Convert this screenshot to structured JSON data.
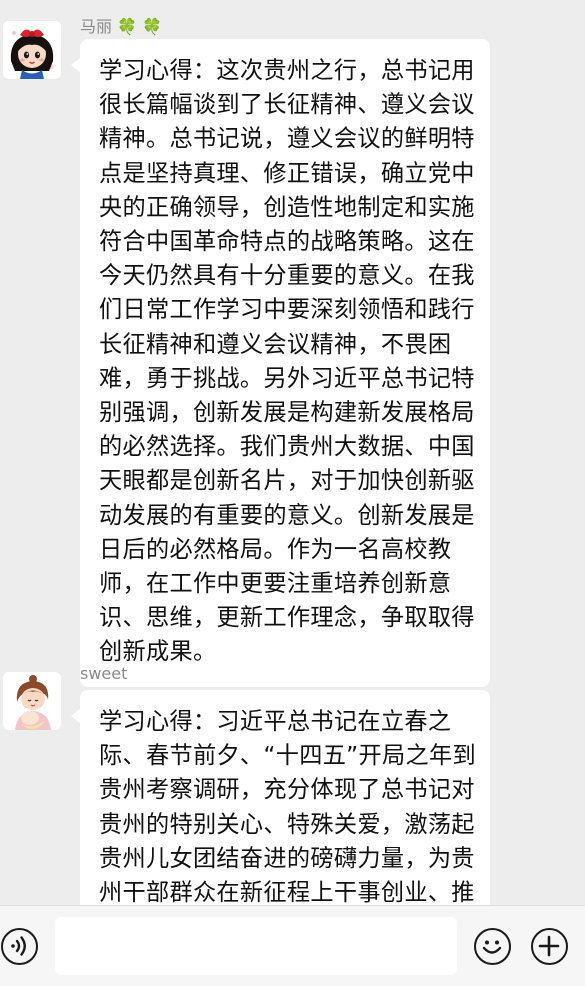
{
  "messages": [
    {
      "sender": "马丽",
      "sender_emoji": "🍀 🍀",
      "avatar_icon": "snow-white-cartoon-avatar",
      "text": "学习心得：这次贵州之行，总书记用很长篇幅谈到了长征精神、遵义会议精神。总书记说，遵义会议的鲜明特点是坚持真理、修正错误，确立党中央的正确领导，创造性地制定和实施符合中国革命特点的战略策略。这在今天仍然具有十分重要的意义。在我们日常工作学习中要深刻领悟和践行长征精神和遵义会议精神，不畏困难，勇于挑战。另外习近平总书记特别强调，创新发展是构建新发展格局的必然选择。我们贵州大数据、中国天眼都是创新名片，对于加快创新驱动发展的有重要的意义。创新发展是日后的必然格局。作为一名高校教师，在工作中更要注重培养创新意识、思维，更新工作理念，争取取得创新成果。"
    },
    {
      "sender": "sweet",
      "avatar_icon": "mother-and-baby-cartoon-avatar",
      "text": "学习心得：习近平总书记在立春之际、春节前夕、“十四五”开局之年到贵州考察调研，充分体现了总书记对贵州的特别关心、特殊关爱，激荡起贵州儿女团结奋进的磅礴力量，为贵州干部群众在新征程上干事创业、推动高质量发展注入了强"
    }
  ],
  "input_bar": {
    "voice_icon": "voice-icon",
    "emoji_icon": "emoji-icon",
    "add_icon": "plus-icon",
    "input_value": ""
  },
  "colors": {
    "background": "#ededed",
    "bubble": "#ffffff",
    "sender_name": "#8a8a8a",
    "text": "#111111"
  }
}
